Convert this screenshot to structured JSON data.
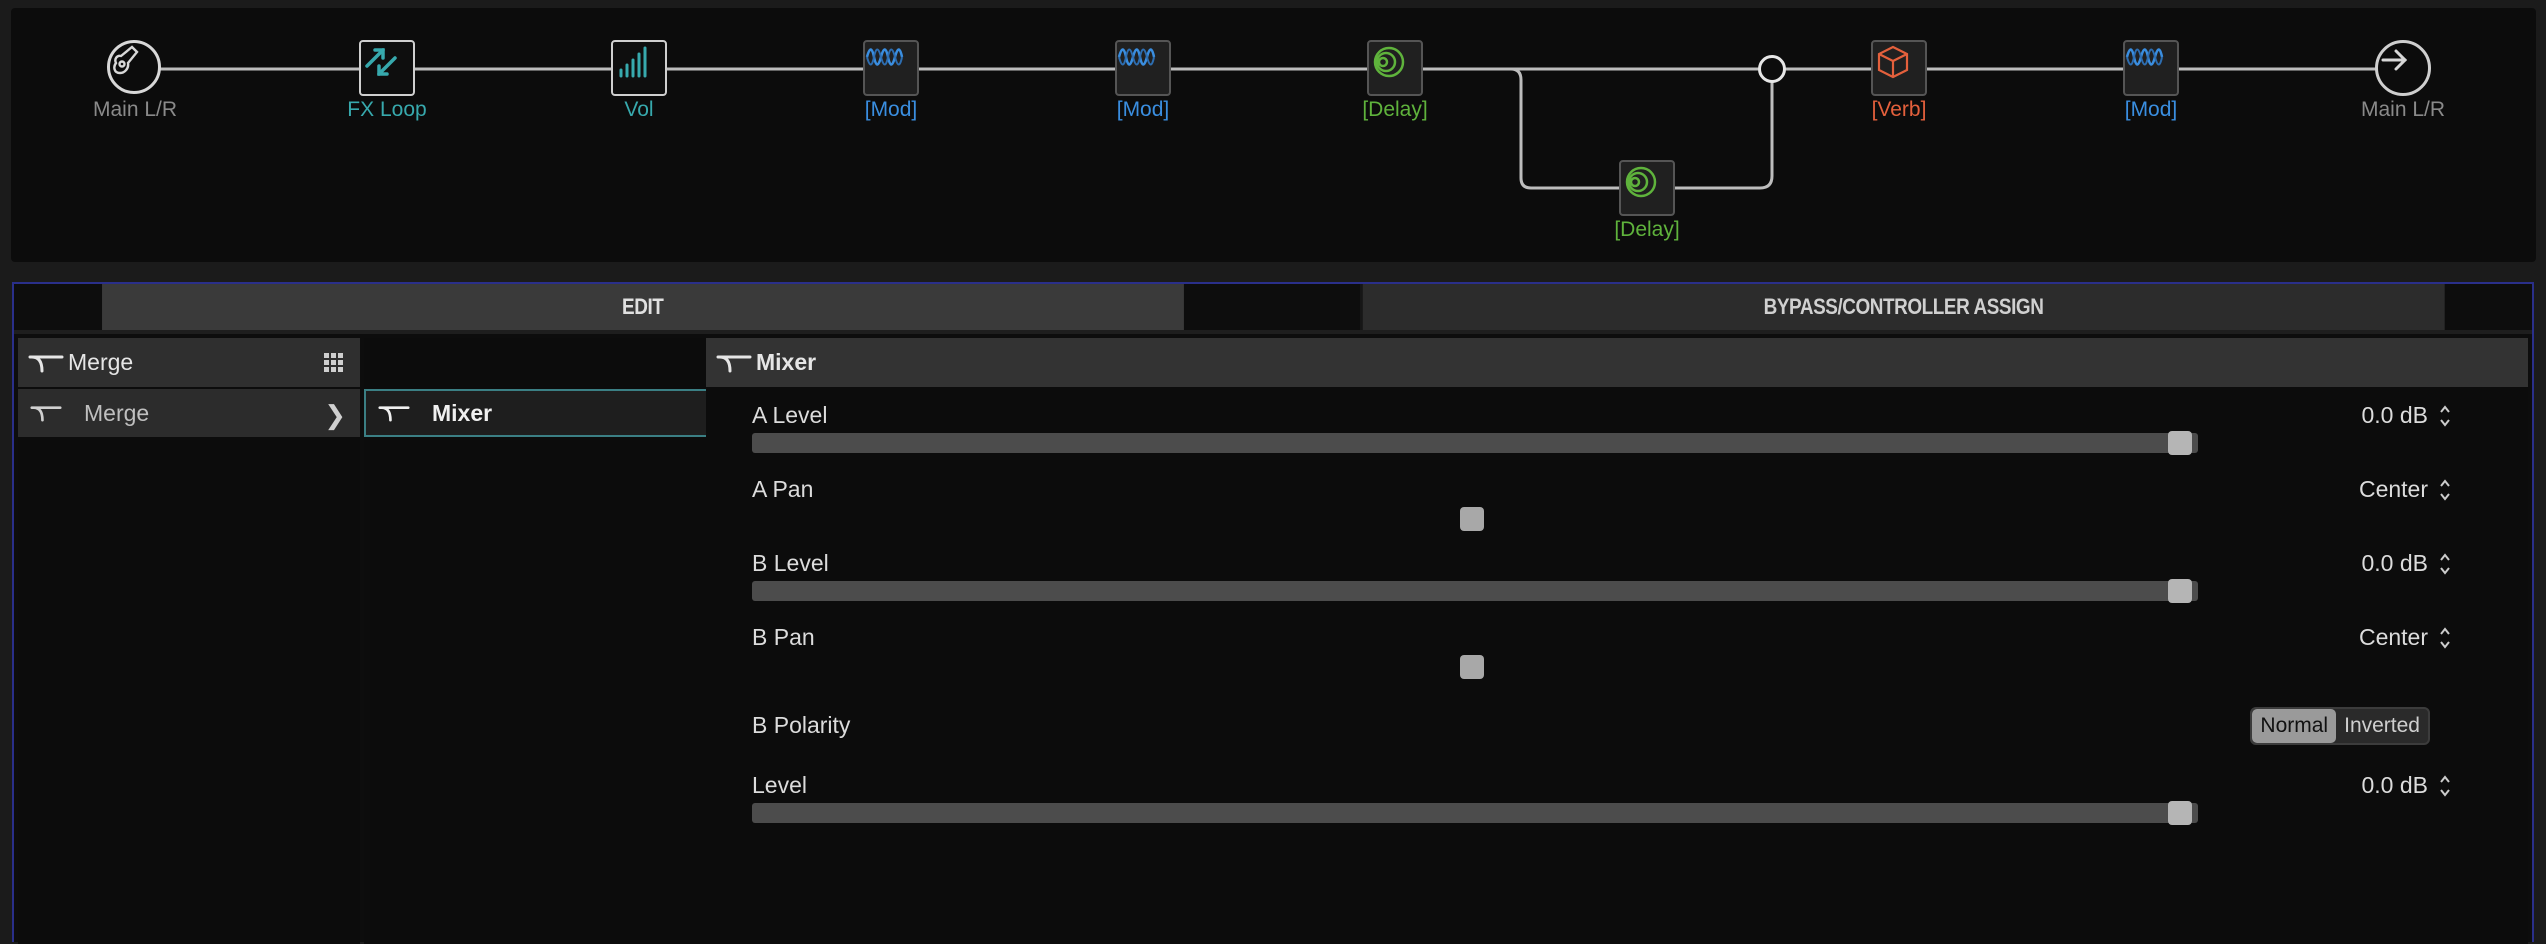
{
  "colors": {
    "teal": "#37a9ad",
    "mod_blue": "#3a8ee0",
    "delay_green": "#5fb33c",
    "verb_orange": "#e4603c",
    "panel_border": "#2a2f8a"
  },
  "chain": {
    "input_label": "Main L/R",
    "fx_loop_label": "FX Loop",
    "vol_label": "Vol",
    "mod1_label": "[Mod]",
    "mod2_label": "[Mod]",
    "delay1_label": "[Delay]",
    "delay2_label": "[Delay]",
    "verb_label": "[Verb]",
    "mod3_label": "[Mod]",
    "output_label": "Main L/R"
  },
  "tabs": {
    "edit": "EDIT",
    "bypass": "BYPASS/CONTROLLER ASSIGN"
  },
  "category": {
    "header": "Merge",
    "item": "Merge"
  },
  "model": {
    "item": "Mixer"
  },
  "params": {
    "header": "Mixer",
    "items": [
      {
        "name": "A Level",
        "value": "0.0 dB",
        "level": 1.0
      },
      {
        "name": "A Pan",
        "value": "Center",
        "level": 0.5
      },
      {
        "name": "B Level",
        "value": "0.0 dB",
        "level": 1.0
      },
      {
        "name": "B Pan",
        "value": "Center",
        "level": 0.5
      },
      {
        "name": "B Polarity",
        "options": [
          "Normal",
          "Inverted"
        ],
        "selected": "Normal"
      },
      {
        "name": "Level",
        "value": "0.0 dB",
        "level": 1.0
      }
    ]
  }
}
